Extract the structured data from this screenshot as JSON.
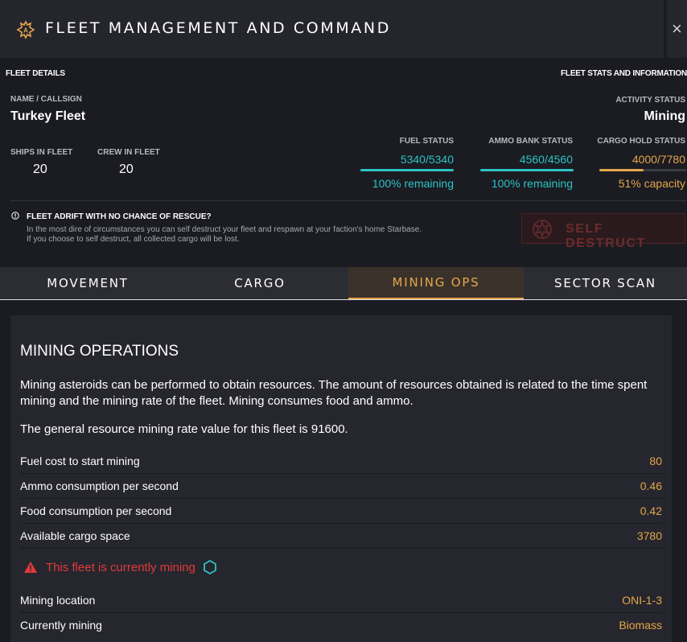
{
  "window": {
    "title": "FLEET MANAGEMENT AND COMMAND",
    "close_label": "×"
  },
  "fleet": {
    "details_header": "FLEET DETAILS",
    "stats_header": "FLEET STATS AND INFORMATION",
    "name_label": "NAME / CALLSIGN",
    "name": "Turkey Fleet",
    "activity_label": "ACTIVITY STATUS",
    "activity": "Mining",
    "ships_label": "SHIPS IN FLEET",
    "ships": "20",
    "crew_label": "CREW IN FLEET",
    "crew": "20",
    "fuel": {
      "label": "FUEL STATUS",
      "value": "5340/5340",
      "sub": "100% remaining",
      "fraction": 1.0
    },
    "ammo": {
      "label": "AMMO BANK STATUS",
      "value": "4560/4560",
      "sub": "100% remaining",
      "fraction": 1.0
    },
    "cargo": {
      "label": "CARGO HOLD STATUS",
      "value": "4000/7780",
      "sub": "51% capacity",
      "fraction": 0.51
    }
  },
  "adrift": {
    "title": "FLEET ADRIFT WITH NO CHANCE OF RESCUE?",
    "line1": "In the most dire of circumstances you can self destruct your fleet and respawn at your faction's home Starbase.",
    "line2": "If you choose to self destruct, all collected cargo will be lost.",
    "button_label": "SELF DESTRUCT"
  },
  "tabs": [
    {
      "label": "MOVEMENT",
      "active": false
    },
    {
      "label": "CARGO",
      "active": false
    },
    {
      "label": "MINING OPS",
      "active": true
    },
    {
      "label": "SECTOR SCAN",
      "active": false
    }
  ],
  "mining": {
    "title": "MINING OPERATIONS",
    "description": "Mining asteroids can be performed to obtain resources. The amount of resources obtained is related to the time spent mining and the mining rate of the fleet. Mining consumes food and ammo.",
    "rate_text": "The general resource mining rate value for this fleet is 91600.",
    "rows": [
      {
        "label": "Fuel cost to start mining",
        "value": "80"
      },
      {
        "label": "Ammo consumption per second",
        "value": "0.46"
      },
      {
        "label": "Food consumption per second",
        "value": "0.42"
      },
      {
        "label": "Available cargo space",
        "value": "3780"
      }
    ],
    "status_text": "This fleet is currently mining",
    "location_label": "Mining location",
    "location": "ONI-1-3",
    "resource_label": "Currently mining",
    "resource": "Biomass"
  },
  "colors": {
    "accent": "#e5a64a",
    "teal": "#2bc4c4",
    "danger": "#e23a3a"
  },
  "icons": {
    "title": "fleet-badge-icon",
    "close": "close-icon",
    "warning": "warning-icon",
    "self_destruct": "explosion-icon",
    "mining": "hexagon-icon"
  }
}
